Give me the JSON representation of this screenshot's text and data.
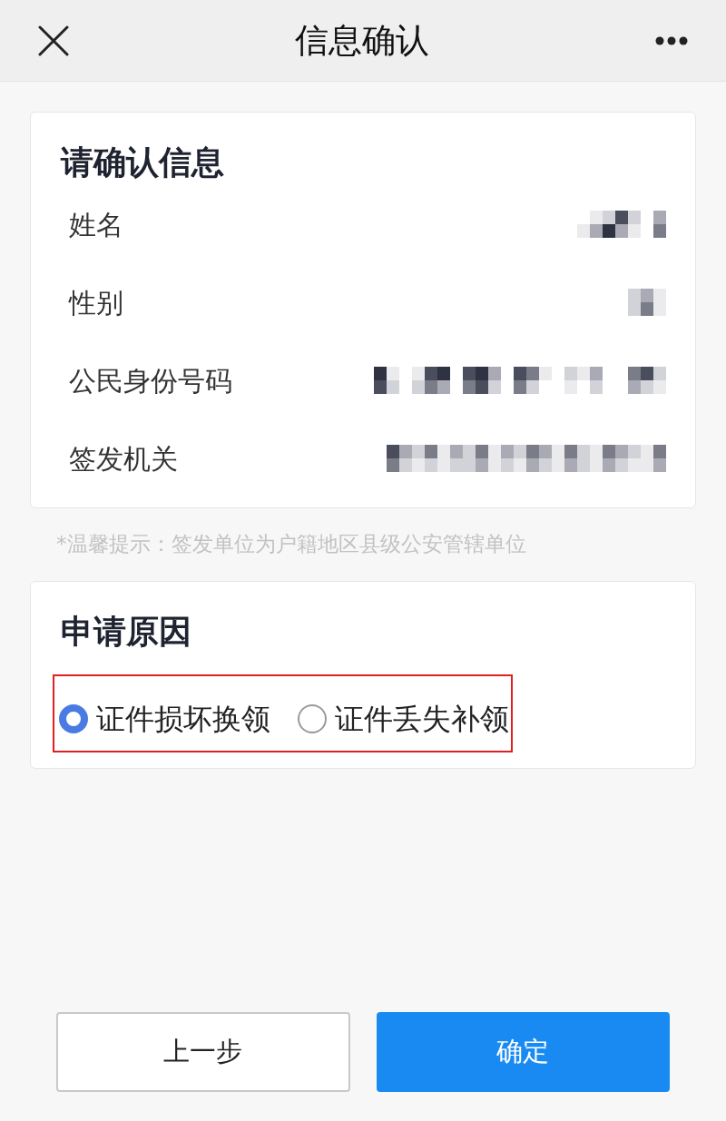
{
  "header": {
    "title": "信息确认"
  },
  "info_card": {
    "title": "请确认信息",
    "rows": [
      {
        "label": "姓名"
      },
      {
        "label": "性别"
      },
      {
        "label": "公民身份号码"
      },
      {
        "label": "签发机关"
      }
    ]
  },
  "hint": "*温馨提示：签发单位为户籍地区县级公安管辖单位",
  "reason_card": {
    "title": "申请原因",
    "options": [
      {
        "label": "证件损坏换领",
        "selected": true
      },
      {
        "label": "证件丢失补领",
        "selected": false
      }
    ]
  },
  "buttons": [
    {
      "label": "上一步",
      "kind": "secondary"
    },
    {
      "label": "确定",
      "kind": "primary"
    }
  ]
}
